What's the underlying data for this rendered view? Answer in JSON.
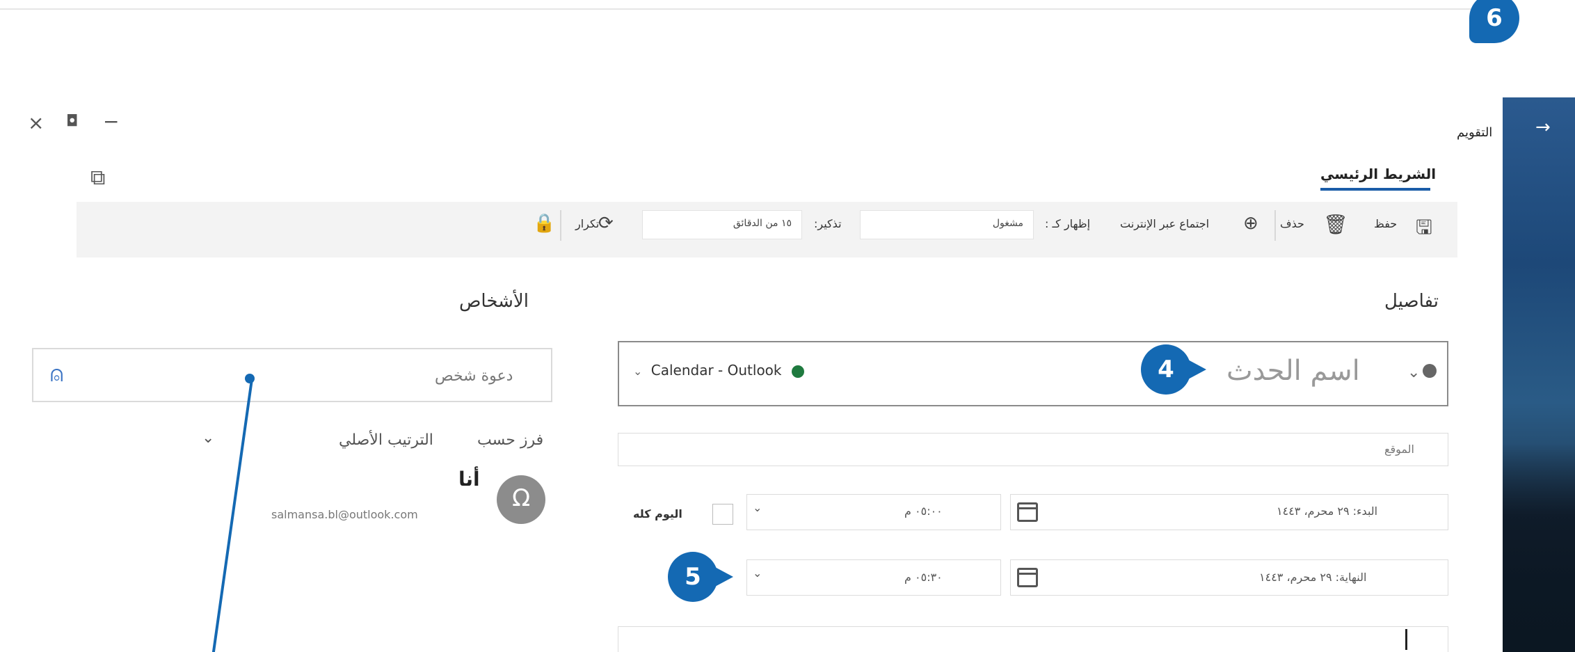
{
  "window": {
    "title": "التقويم",
    "close_icon": "close-icon",
    "restore_icon": "restore-icon",
    "minimize_icon": "minimize-icon"
  },
  "sidebar": {
    "arrow_label": "→"
  },
  "ribbon": {
    "tab_label": "الشريط الرئيسي",
    "save_label": "حفظ",
    "delete_label": "حذف",
    "online_meeting_label": "اجتماع عبر الإنترنت",
    "show_as_label": "إظهار كـ :",
    "show_as_value": "مشغول",
    "reminder_label": "تذكير:",
    "reminder_value": "١٥ من الدقائق",
    "repeat_label": "تكرار"
  },
  "details": {
    "title": "تفاصيل",
    "event_name_placeholder": "اسم الحدث",
    "calendar_selector": "Calendar - Outlook",
    "location_placeholder": "الموقع",
    "start_label": "البدء:",
    "start_date": "٢٩ محرم، ١٤٤٣",
    "start_time": "٠٥:٠٠ م",
    "end_label": "النهاية:",
    "end_date": "٢٩ محرم، ١٤٤٣",
    "end_time": "٠٥:٣٠ م",
    "all_day_label": "اليوم كله"
  },
  "people": {
    "title": "الأشخاص",
    "invite_placeholder": "دعوة شخص",
    "sort_label": "فرز حسب",
    "sort_value": "الترتيب الأصلي",
    "me_label": "أنا",
    "me_email": "salmansa.bl@outlook.com",
    "avatar_glyph": "Ω"
  },
  "callouts": {
    "c4": "4",
    "c5": "5",
    "c6": "6"
  },
  "colors": {
    "accent": "#1469b3",
    "ribbon_underline": "#1a5ca8",
    "calendar_dot": "#1f7a3f"
  }
}
